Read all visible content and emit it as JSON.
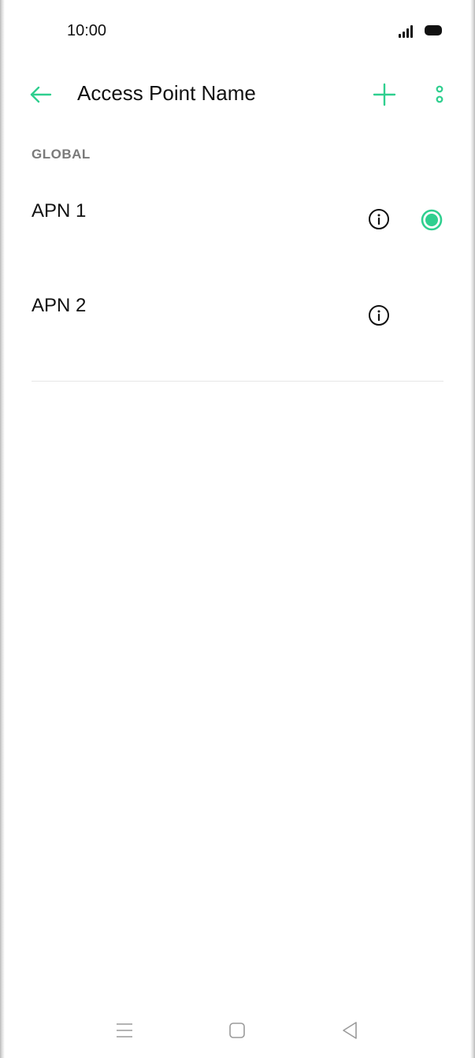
{
  "status_bar": {
    "time": "10:00"
  },
  "header": {
    "title": "Access Point Name",
    "back_icon": "arrow-left-icon",
    "add_icon": "plus-icon",
    "more_icon": "more-vertical-icon"
  },
  "section": {
    "label": "GLOBAL"
  },
  "apn_list": [
    {
      "label": "APN 1",
      "selected": true
    },
    {
      "label": "APN 2",
      "selected": false
    }
  ],
  "nav_bar": {
    "icons": [
      "menu-icon",
      "home-icon",
      "back-triangle-icon"
    ]
  },
  "colors": {
    "accent": "#2fcf8f",
    "text_primary": "#111111",
    "text_secondary": "#7a7a7a",
    "divider": "#e6e6e6",
    "nav_icon": "#9a9a9a"
  }
}
